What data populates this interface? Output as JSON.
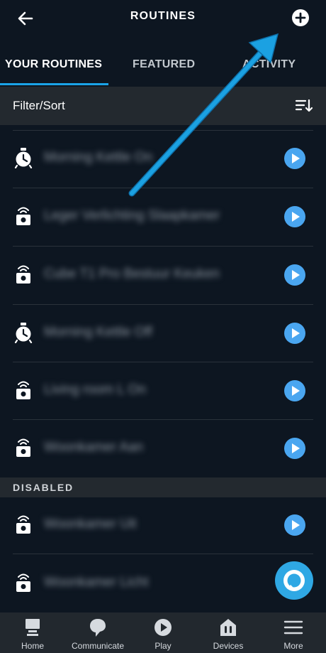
{
  "header": {
    "title": "ROUTINES"
  },
  "tabs": [
    {
      "label": "YOUR ROUTINES",
      "active": true
    },
    {
      "label": "FEATURED",
      "active": false
    },
    {
      "label": "ACTIVITY",
      "active": false
    }
  ],
  "filter": {
    "label": "Filter/Sort"
  },
  "routines": [
    {
      "label": "Morning Kettle On",
      "icon": "alarm-clock-icon"
    },
    {
      "label": "Leger Verlichting Slaapkamer",
      "icon": "smart-home-icon"
    },
    {
      "label": "Cube T1 Pro Bestuur Keuken",
      "icon": "smart-home-icon"
    },
    {
      "label": "Morning Kettle Off",
      "icon": "alarm-clock-icon"
    },
    {
      "label": "Living room L On",
      "icon": "smart-home-icon"
    },
    {
      "label": "Woonkamer Aan",
      "icon": "smart-home-icon"
    }
  ],
  "disabled_section": {
    "label": "DISABLED"
  },
  "disabled_routines": [
    {
      "label": "Woonkamer Uit",
      "icon": "smart-home-icon"
    },
    {
      "label": "Woonkamer Licht",
      "icon": "smart-home-icon"
    }
  ],
  "bottom_nav": [
    {
      "label": "Home",
      "icon": "home-icon"
    },
    {
      "label": "Communicate",
      "icon": "chat-bubble-icon"
    },
    {
      "label": "Play",
      "icon": "play-icon"
    },
    {
      "label": "Devices",
      "icon": "devices-icon"
    },
    {
      "label": "More",
      "icon": "menu-icon"
    }
  ],
  "colors": {
    "background": "#0d1621",
    "accent": "#1aa3e8",
    "play_button": "#4aa6f0",
    "bar": "#23292f"
  }
}
